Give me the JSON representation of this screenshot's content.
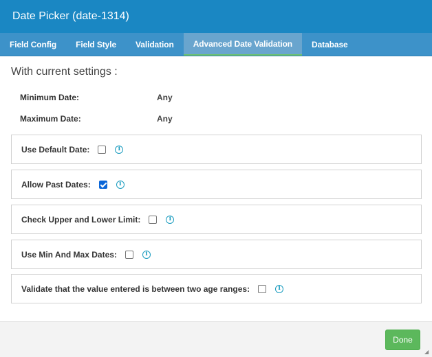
{
  "window": {
    "title": "Date Picker (date-1314)"
  },
  "tabs": [
    {
      "label": "Field Config"
    },
    {
      "label": "Field Style"
    },
    {
      "label": "Validation"
    },
    {
      "label": "Advanced Date Validation"
    },
    {
      "label": "Database"
    }
  ],
  "active_tab": "Advanced Date Validation",
  "settings": {
    "heading": "With current settings :",
    "min_label": "Minimum Date:",
    "min_value": "Any",
    "max_label": "Maximum Date:",
    "max_value": "Any"
  },
  "options": [
    {
      "label": "Use Default Date:",
      "checked": false,
      "info_icon": "info-icon"
    },
    {
      "label": "Allow Past Dates:",
      "checked": true,
      "info_icon": "info-icon"
    },
    {
      "label": "Check Upper and Lower Limit:",
      "checked": false,
      "info_icon": "info-icon"
    },
    {
      "label": "Use Min And Max Dates:",
      "checked": false,
      "info_icon": "info-icon"
    },
    {
      "label": "Validate that the value entered is between two age ranges:",
      "checked": false,
      "info_icon": "info-icon"
    }
  ],
  "footer": {
    "done_label": "Done"
  },
  "colors": {
    "titlebar": "#1a87c3",
    "tabbar": "#3d92c9",
    "active_tab": "#69a5ce",
    "active_tab_underline": "#6cc26a",
    "done_button": "#5cb85c",
    "checkbox_checked": "#0a66d8",
    "info_icon": "#1a9cbf"
  }
}
